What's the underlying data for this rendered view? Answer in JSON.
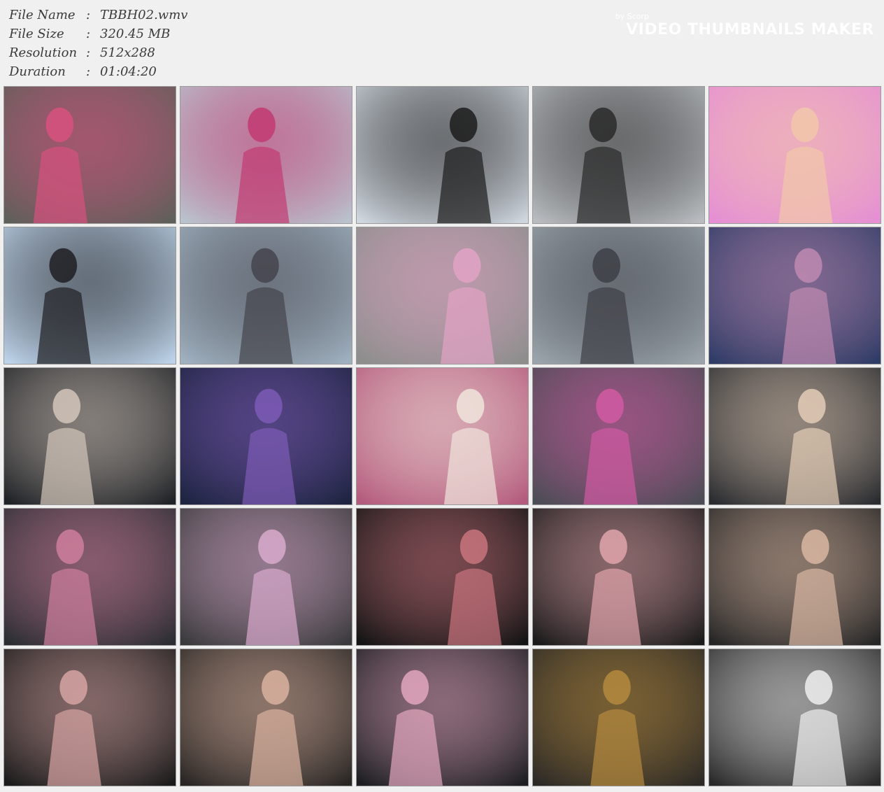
{
  "info": {
    "rows": [
      {
        "label": "File Name",
        "sep": ":",
        "value": "TBBH02.wmv"
      },
      {
        "label": "File Size",
        "sep": ":",
        "value": "320.45 MB"
      },
      {
        "label": "Resolution",
        "sep": ":",
        "value": "512x288"
      },
      {
        "label": "Duration",
        "sep": ":",
        "value": "01:04:20"
      }
    ]
  },
  "watermark": {
    "by": "by Scorp",
    "brand": "VIDEO THUMBNAILS MAKER"
  },
  "thumbnails": [
    {
      "name": "thumb-pink-suit-cage",
      "bg": "#5f5f5a",
      "fg": "#d7517f"
    },
    {
      "name": "thumb-masked-closeup",
      "bg": "#b9c2cd",
      "fg": "#c23a72"
    },
    {
      "name": "thumb-black-suits-rooftop",
      "bg": "#cfd6de",
      "fg": "#1c1c1c"
    },
    {
      "name": "thumb-schoolgirl-rooftop",
      "bg": "#b8bcc0",
      "fg": "#2a2a2a"
    },
    {
      "name": "thumb-colorful-transform",
      "bg": "#e58fd4",
      "fg": "#f2c7a9"
    },
    {
      "name": "thumb-black-figure-fight",
      "bg": "#bcd2e8",
      "fg": "#1f1f22"
    },
    {
      "name": "thumb-armored-villain",
      "bg": "#9fb0bf",
      "fg": "#44444c"
    },
    {
      "name": "thumb-heroine-on-ground",
      "bg": "#8c8e8c",
      "fg": "#e2a2c4"
    },
    {
      "name": "thumb-villain-holding-heroine",
      "bg": "#9aa4ab",
      "fg": "#3d3f45"
    },
    {
      "name": "thumb-blue-light-duel",
      "bg": "#2f3c66",
      "fg": "#c08ab1"
    },
    {
      "name": "thumb-dark-heroine-kneel",
      "bg": "#1f2226",
      "fg": "#d3c6bb"
    },
    {
      "name": "thumb-blue-light-cape",
      "bg": "#1d2440",
      "fg": "#7d5bb6"
    },
    {
      "name": "thumb-injured-belt",
      "bg": "#b45a7c",
      "fg": "#f0e4dc"
    },
    {
      "name": "thumb-heroine-lying",
      "bg": "#4b4c55",
      "fg": "#d25aa3"
    },
    {
      "name": "thumb-masked-struggle",
      "bg": "#2a2c30",
      "fg": "#e4cdb7"
    },
    {
      "name": "thumb-spiked-mace",
      "bg": "#2b2d33",
      "fg": "#cf7f9c"
    },
    {
      "name": "thumb-heroine-dragged",
      "bg": "#3a3a3c",
      "fg": "#d9aacd"
    },
    {
      "name": "thumb-crucified-dark",
      "bg": "#141414",
      "fg": "#c9747e"
    },
    {
      "name": "thumb-crucified-closeup",
      "bg": "#1a1a1a",
      "fg": "#e0a4ab"
    },
    {
      "name": "thumb-mask-crucified",
      "bg": "#262626",
      "fg": "#d9b7a2"
    },
    {
      "name": "thumb-cross-chains",
      "bg": "#1b1b1b",
      "fg": "#d5a4a3"
    },
    {
      "name": "thumb-arms-chained",
      "bg": "#292624",
      "fg": "#dab2a0"
    },
    {
      "name": "thumb-kneeling-cross",
      "bg": "#1c1e22",
      "fg": "#e3a6bd"
    },
    {
      "name": "thumb-golden-helmet",
      "bg": "#2b2926",
      "fg": "#b58a3e"
    },
    {
      "name": "thumb-white-boots",
      "bg": "#2a2a2a",
      "fg": "#eeeeee"
    }
  ]
}
